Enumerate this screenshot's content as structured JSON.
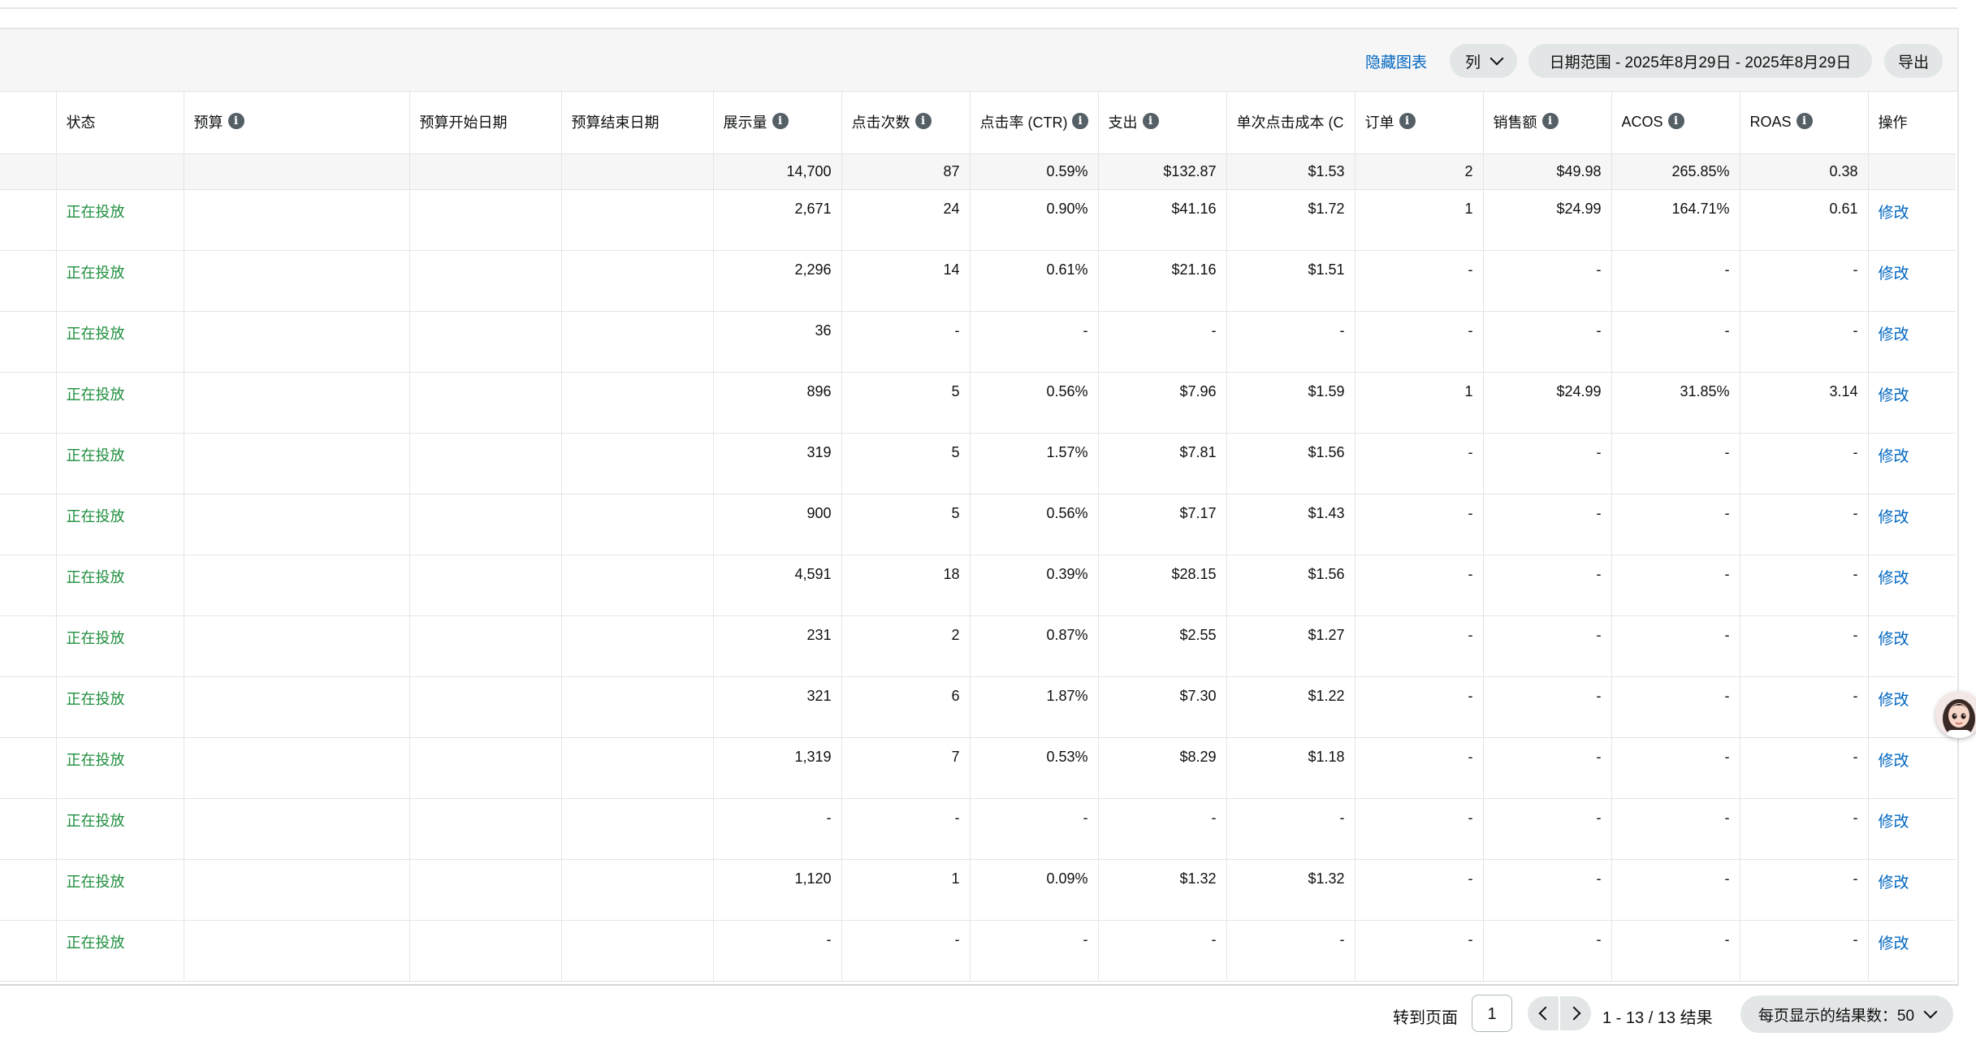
{
  "toolbar": {
    "hide_chart": "隐藏图表",
    "columns": "列",
    "date_range": "日期范围 - 2025年8月29日 - 2025年8月29日",
    "export": "导出"
  },
  "table": {
    "headers": {
      "status": "状态",
      "budget": "预算",
      "budget_start": "预算开始日期",
      "budget_end": "预算结束日期",
      "impressions": "展示量",
      "clicks": "点击次数",
      "ctr": "点击率 (CTR)",
      "spend": "支出",
      "cpc": "单次点击成本 (CPC)",
      "orders": "订单",
      "sales": "销售额",
      "acos": "ACOS",
      "roas": "ROAS",
      "actions": "操作"
    },
    "totals": {
      "impressions": "14,700",
      "clicks": "87",
      "ctr": "0.59%",
      "spend": "$132.87",
      "cpc": "$1.53",
      "orders": "2",
      "sales": "$49.98",
      "acos": "265.85%",
      "roas": "0.38"
    },
    "rows": [
      {
        "status": "正在投放",
        "impressions": "2,671",
        "clicks": "24",
        "ctr": "0.90%",
        "spend": "$41.16",
        "cpc": "$1.72",
        "orders": "1",
        "sales": "$24.99",
        "acos": "164.71%",
        "roas": "0.61",
        "action": "修改"
      },
      {
        "status": "正在投放",
        "impressions": "2,296",
        "clicks": "14",
        "ctr": "0.61%",
        "spend": "$21.16",
        "cpc": "$1.51",
        "orders": "-",
        "sales": "-",
        "acos": "-",
        "roas": "-",
        "action": "修改"
      },
      {
        "status": "正在投放",
        "impressions": "36",
        "clicks": "-",
        "ctr": "-",
        "spend": "-",
        "cpc": "-",
        "orders": "-",
        "sales": "-",
        "acos": "-",
        "roas": "-",
        "action": "修改"
      },
      {
        "status": "正在投放",
        "impressions": "896",
        "clicks": "5",
        "ctr": "0.56%",
        "spend": "$7.96",
        "cpc": "$1.59",
        "orders": "1",
        "sales": "$24.99",
        "acos": "31.85%",
        "roas": "3.14",
        "action": "修改"
      },
      {
        "status": "正在投放",
        "impressions": "319",
        "clicks": "5",
        "ctr": "1.57%",
        "spend": "$7.81",
        "cpc": "$1.56",
        "orders": "-",
        "sales": "-",
        "acos": "-",
        "roas": "-",
        "action": "修改"
      },
      {
        "status": "正在投放",
        "impressions": "900",
        "clicks": "5",
        "ctr": "0.56%",
        "spend": "$7.17",
        "cpc": "$1.43",
        "orders": "-",
        "sales": "-",
        "acos": "-",
        "roas": "-",
        "action": "修改"
      },
      {
        "status": "正在投放",
        "impressions": "4,591",
        "clicks": "18",
        "ctr": "0.39%",
        "spend": "$28.15",
        "cpc": "$1.56",
        "orders": "-",
        "sales": "-",
        "acos": "-",
        "roas": "-",
        "action": "修改"
      },
      {
        "status": "正在投放",
        "impressions": "231",
        "clicks": "2",
        "ctr": "0.87%",
        "spend": "$2.55",
        "cpc": "$1.27",
        "orders": "-",
        "sales": "-",
        "acos": "-",
        "roas": "-",
        "action": "修改"
      },
      {
        "status": "正在投放",
        "impressions": "321",
        "clicks": "6",
        "ctr": "1.87%",
        "spend": "$7.30",
        "cpc": "$1.22",
        "orders": "-",
        "sales": "-",
        "acos": "-",
        "roas": "-",
        "action": "修改"
      },
      {
        "status": "正在投放",
        "impressions": "1,319",
        "clicks": "7",
        "ctr": "0.53%",
        "spend": "$8.29",
        "cpc": "$1.18",
        "orders": "-",
        "sales": "-",
        "acos": "-",
        "roas": "-",
        "action": "修改"
      },
      {
        "status": "正在投放",
        "impressions": "-",
        "clicks": "-",
        "ctr": "-",
        "spend": "-",
        "cpc": "-",
        "orders": "-",
        "sales": "-",
        "acos": "-",
        "roas": "-",
        "action": "修改"
      },
      {
        "status": "正在投放",
        "impressions": "1,120",
        "clicks": "1",
        "ctr": "0.09%",
        "spend": "$1.32",
        "cpc": "$1.32",
        "orders": "-",
        "sales": "-",
        "acos": "-",
        "roas": "-",
        "action": "修改"
      },
      {
        "status": "正在投放",
        "impressions": "-",
        "clicks": "-",
        "ctr": "-",
        "spend": "-",
        "cpc": "-",
        "orders": "-",
        "sales": "-",
        "acos": "-",
        "roas": "-",
        "action": "修改"
      }
    ]
  },
  "footer": {
    "goto_label": "转到页面",
    "page_value": "1",
    "results": "1 - 13 / 13 结果",
    "per_page": "每页显示的结果数：50"
  },
  "icons": {
    "info": "info-icon",
    "chevron": "chevron-down-icon",
    "prev": "chevron-left-icon",
    "next": "chevron-right-icon",
    "assistant": "assistant-avatar-icon"
  },
  "colors": {
    "status_active": "#1e8e3e",
    "link": "#0066c0",
    "pill_bg": "#e3e6e6",
    "toolbar_bg": "#f6f6f6"
  }
}
